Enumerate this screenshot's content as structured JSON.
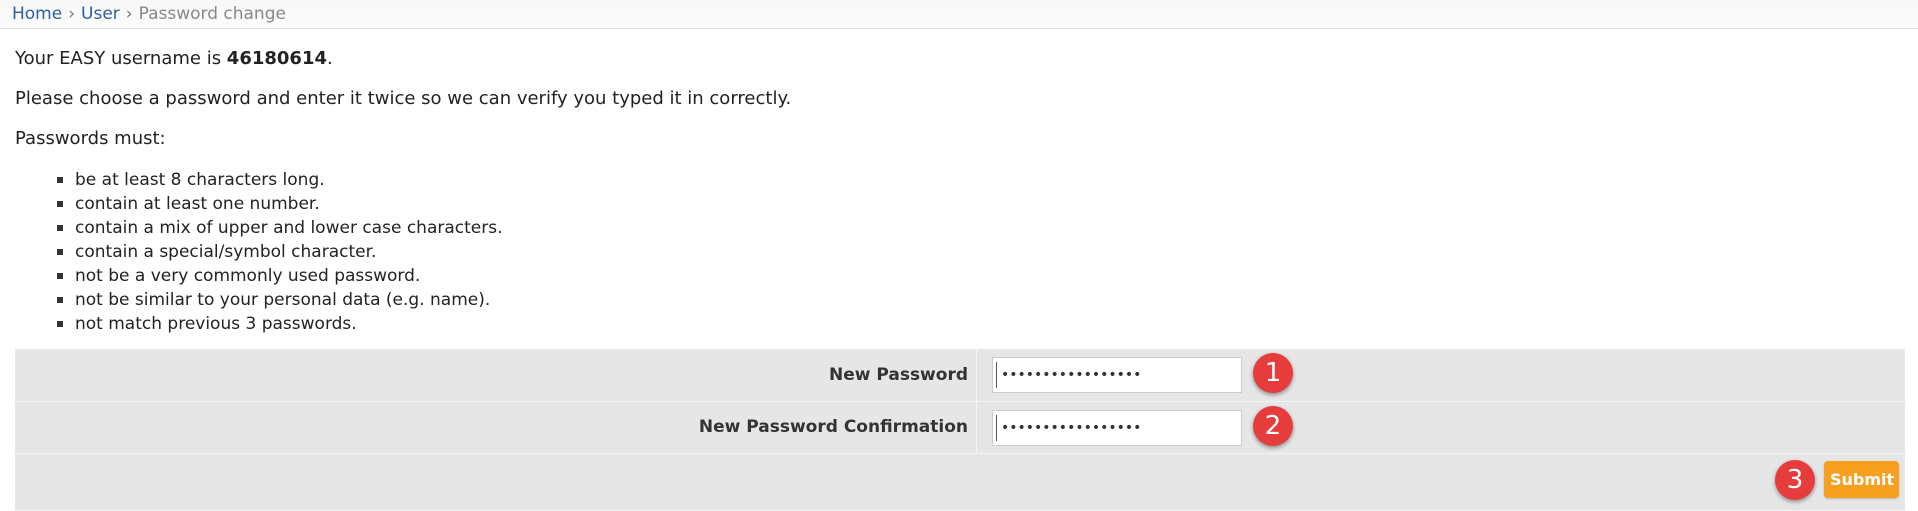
{
  "breadcrumb": {
    "items": [
      "Home",
      "User",
      "Password change"
    ],
    "separator": "›"
  },
  "intro": {
    "username_prefix": "Your EASY username is ",
    "username": "46180614",
    "username_suffix": ".",
    "instruction": "Please choose a password and enter it twice so we can verify you typed it in correctly.",
    "rules_heading": "Passwords must:"
  },
  "rules": [
    "be at least 8 characters long.",
    "contain at least one number.",
    "contain a mix of upper and lower case characters.",
    "contain a special/symbol character.",
    "not be a very commonly used password.",
    "not be similar to your personal data (e.g. name).",
    "not match previous 3 passwords."
  ],
  "form": {
    "new_password_label": "New Password",
    "new_password_value": "•••••••••••••••••",
    "confirm_password_label": "New Password Confirmation",
    "confirm_password_value": "•••••••••••••••••",
    "submit_label": "Submit"
  },
  "annotations": [
    "1",
    "2",
    "3"
  ],
  "colors": {
    "link": "#2f5f9e",
    "submit": "#f7a020",
    "badge": "#e73c3c",
    "row_background": "#e6e6e6"
  }
}
